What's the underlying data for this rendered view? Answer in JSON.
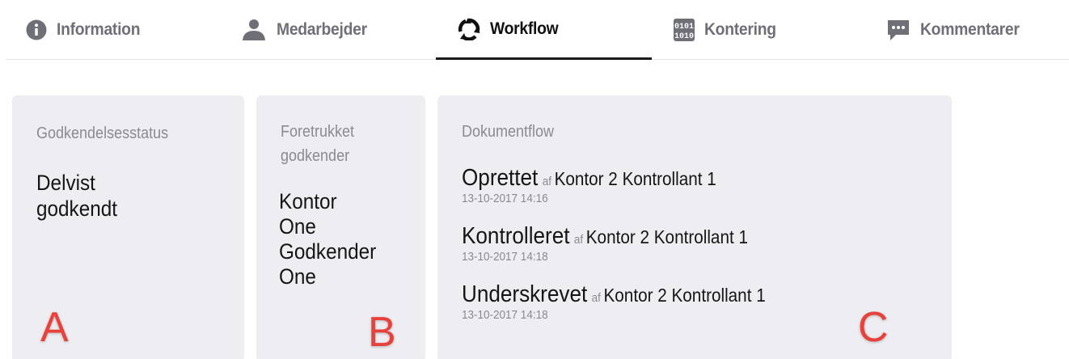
{
  "tabs": [
    {
      "label": "Information",
      "icon": "info-icon",
      "active": false
    },
    {
      "label": "Medarbejder",
      "icon": "person-icon",
      "active": false
    },
    {
      "label": "Workflow",
      "icon": "workflow-icon",
      "active": true
    },
    {
      "label": "Kontering",
      "icon": "binary-icon",
      "active": false
    },
    {
      "label": "Kommentarer",
      "icon": "comment-icon",
      "active": false
    }
  ],
  "approval_status": {
    "label": "Godkendelsesstatus",
    "value_line1": "Delvist",
    "value_line2": "godkendt"
  },
  "preferred_approver": {
    "label_line1": "Foretrukket",
    "label_line2": "godkender",
    "value_lines": [
      "Kontor",
      "One",
      "Godkender",
      "One"
    ]
  },
  "document_flow": {
    "label": "Dokumentflow",
    "by_word": "af",
    "entries": [
      {
        "action": "Oprettet",
        "user": "Kontor 2 Kontrollant 1",
        "timestamp": "13-10-2017 14:16"
      },
      {
        "action": "Kontrolleret",
        "user": "Kontor 2 Kontrollant 1",
        "timestamp": "13-10-2017 14:18"
      },
      {
        "action": "Underskrevet",
        "user": "Kontor 2 Kontrollant 1",
        "timestamp": "13-10-2017 14:18"
      }
    ]
  },
  "markers": {
    "a": "A",
    "b": "B",
    "c": "C"
  },
  "colors": {
    "card_bg": "#eeeef2",
    "marker": "#e8413c",
    "active_tab": "#111111",
    "inactive_tab": "#6f6f78"
  }
}
